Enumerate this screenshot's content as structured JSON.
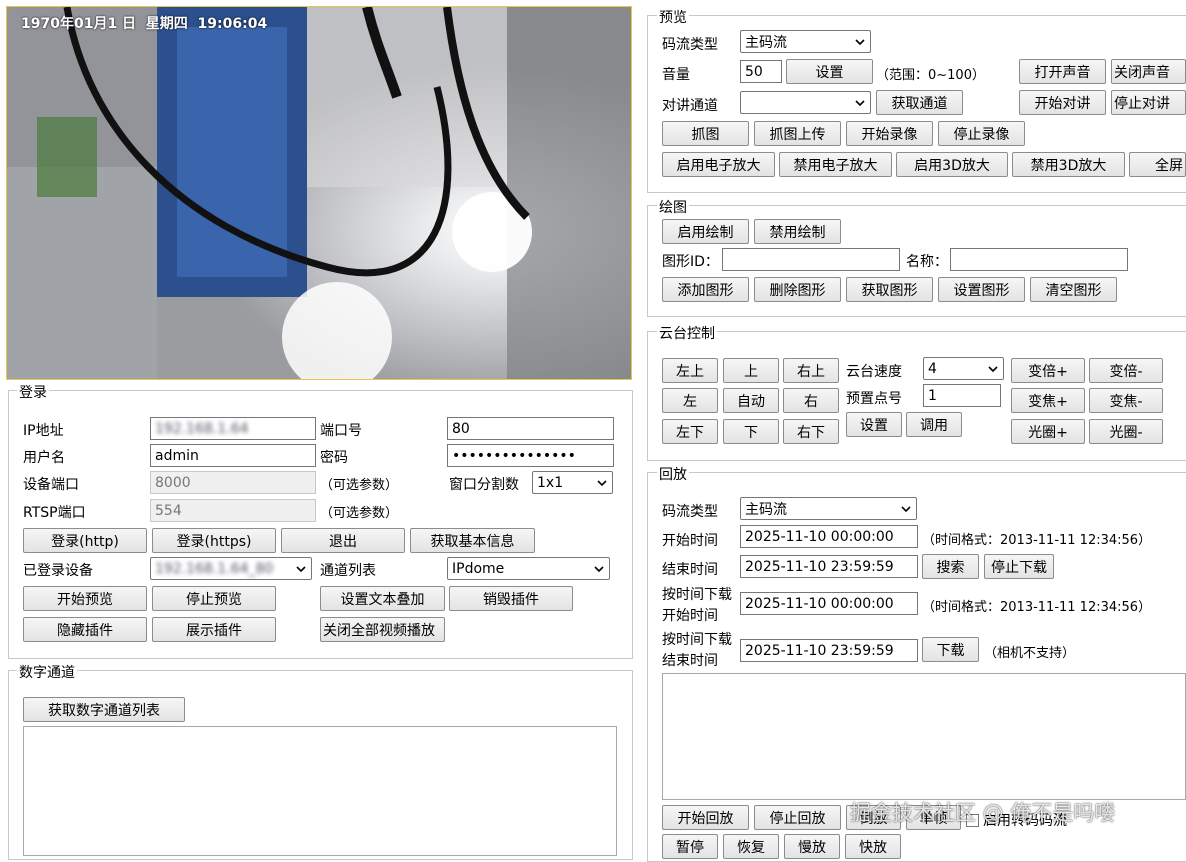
{
  "video": {
    "timestamp": "1970年01月1 日  星期四  19:06:04"
  },
  "login": {
    "legend": "登录",
    "ip_label": "IP地址",
    "ip_value": "192.168.1.64",
    "port_label": "端口号",
    "port_value": "80",
    "user_label": "用户名",
    "user_value": "admin",
    "pwd_label": "密码",
    "pwd_value": "•••••••••••••••",
    "devport_label": "设备端口",
    "devport_value": "8000",
    "optional1": "（可选参数）",
    "window_label": "窗口分割数",
    "window_value": "1x1",
    "rtsp_label": "RTSP端口",
    "rtsp_value": "554",
    "optional2": "（可选参数）",
    "btn_login_http": "登录(http)",
    "btn_login_https": "登录(https)",
    "btn_logout": "退出",
    "btn_get_info": "获取基本信息",
    "logged_label": "已登录设备",
    "logged_value": "192.168.1.64_80",
    "channel_label": "通道列表",
    "channel_value": "IPdome",
    "btn_start_preview": "开始预览",
    "btn_stop_preview": "停止预览",
    "btn_set_text": "设置文本叠加",
    "btn_destroy_plugin": "销毁插件",
    "btn_hide_plugin": "隐藏插件",
    "btn_show_plugin": "展示插件",
    "btn_close_all": "关闭全部视频播放"
  },
  "digital": {
    "legend": "数字通道",
    "btn_get_list": "获取数字通道列表"
  },
  "preview": {
    "legend": "预览",
    "stream_label": "码流类型",
    "stream_value": "主码流",
    "volume_label": "音量",
    "volume_value": "50",
    "btn_set": "设置",
    "volume_range": "（范围：0~100）",
    "btn_open_sound": "打开声音",
    "btn_close_sound": "关闭声音",
    "talk_label": "对讲通道",
    "talk_value": "",
    "btn_get_channel": "获取通道",
    "btn_start_talk": "开始对讲",
    "btn_stop_talk": "停止对讲",
    "btn_capture": "抓图",
    "btn_capture_upload": "抓图上传",
    "btn_start_rec": "开始录像",
    "btn_stop_rec": "停止录像",
    "btn_enable_ezoom": "启用电子放大",
    "btn_disable_ezoom": "禁用电子放大",
    "btn_enable_3d": "启用3D放大",
    "btn_disable_3d": "禁用3D放大",
    "btn_fullscreen": "全屏"
  },
  "drawing": {
    "legend": "绘图",
    "btn_enable": "启用绘制",
    "btn_disable": "禁用绘制",
    "shape_id_label": "图形ID：",
    "name_label": "名称：",
    "btn_add": "添加图形",
    "btn_delete": "删除图形",
    "btn_get": "获取图形",
    "btn_set": "设置图形",
    "btn_clear": "清空图形"
  },
  "ptz": {
    "legend": "云台控制",
    "btn_up_left": "左上",
    "btn_up": "上",
    "btn_up_right": "右上",
    "btn_left": "左",
    "btn_auto": "自动",
    "btn_right": "右",
    "btn_down_left": "左下",
    "btn_down": "下",
    "btn_down_right": "右下",
    "speed_label": "云台速度",
    "speed_value": "4",
    "preset_label": "预置点号",
    "preset_value": "1",
    "btn_preset_set": "设置",
    "btn_preset_call": "调用",
    "btn_zoom_in": "变倍+",
    "btn_zoom_out": "变倍-",
    "btn_focus_in": "变焦+",
    "btn_focus_out": "变焦-",
    "btn_iris_in": "光圈+",
    "btn_iris_out": "光圈-"
  },
  "playback": {
    "legend": "回放",
    "stream_label": "码流类型",
    "stream_value": "主码流",
    "start_label": "开始时间",
    "start_value": "2025-11-10 00:00:00",
    "time_format1": "（时间格式：2013-11-11 12:34:56）",
    "end_label": "结束时间",
    "end_value": "2025-11-10 23:59:59",
    "btn_search": "搜索",
    "btn_stop_download": "停止下载",
    "dl_start_label_1": "按时间下载",
    "dl_start_label_2": "开始时间",
    "dl_start_value": "2025-11-10 00:00:00",
    "time_format2": "（时间格式：2013-11-11 12:34:56）",
    "dl_end_label_1": "按时间下载",
    "dl_end_label_2": "结束时间",
    "dl_end_value": "2025-11-10 23:59:59",
    "btn_download": "下载",
    "camera_unsupported": "（相机不支持）",
    "btn_start_playback": "开始回放",
    "btn_stop_playback": "停止回放",
    "btn_reverse": "倒放",
    "btn_single_frame": "单帧",
    "chk_enable_transcode": "启用转码码流",
    "btn_pause": "暂停",
    "btn_resume": "恢复",
    "btn_slow": "慢放",
    "btn_fast": "快放"
  },
  "watermark": "掘金技术社区 @ 俺不是吗喽"
}
